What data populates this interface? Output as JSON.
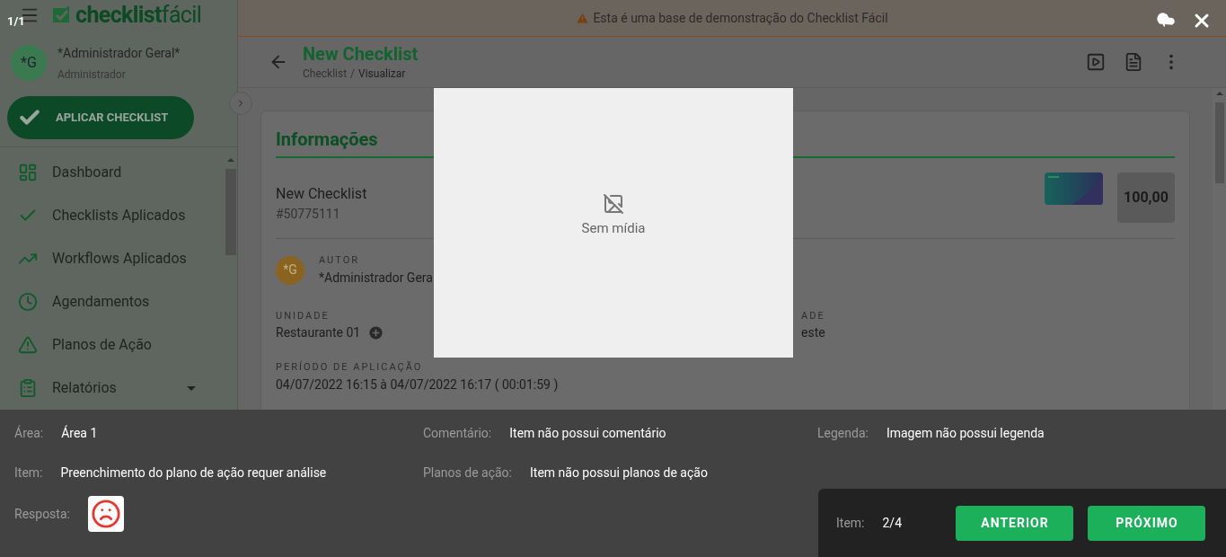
{
  "banner": "Esta é uma base de demonstração do Checklist Fácil",
  "sidebar": {
    "logo": {
      "bold": "checklist",
      "light": "fácil"
    },
    "user": {
      "initials": "*G",
      "name": "*Administrador Geral*",
      "role": "Administrador"
    },
    "action": "APLICAR CHECKLIST",
    "items": [
      {
        "label": "Dashboard",
        "expandable": false
      },
      {
        "label": "Checklists Aplicados",
        "expandable": false
      },
      {
        "label": "Workflows Aplicados",
        "expandable": false
      },
      {
        "label": "Agendamentos",
        "expandable": false
      },
      {
        "label": "Planos de Ação",
        "expandable": false
      },
      {
        "label": "Relatórios",
        "expandable": true
      }
    ]
  },
  "header": {
    "title": "New Checklist",
    "breadcrumb": [
      "Checklist",
      "Visualizar"
    ],
    "breadcrumb_separator": "/"
  },
  "info": {
    "heading": "Informações",
    "name": "New Checklist",
    "id": "#50775111",
    "score": "100,00",
    "author": {
      "initials": "*G",
      "label": "AUTOR",
      "name": "*Administrador Gera"
    },
    "unit": {
      "label": "UNIDADE",
      "value": "Restaurante 01"
    },
    "field_2": {
      "label": "ADE",
      "value": "este"
    },
    "period": {
      "label": "PERÍODO DE APLICAÇÃO",
      "value": "04/07/2022 16:15 à 04/07/2022 16:17 ( 00:01:59 )"
    }
  },
  "lightbox": {
    "counter": "1/1",
    "media": {
      "message": "Sem mídia"
    },
    "details": [
      {
        "label": "Área:",
        "value": "Área 1"
      },
      {
        "label": "Comentário:",
        "value": "Item não possui comentário"
      },
      {
        "label": "Legenda:",
        "value": "Imagem não possui legenda"
      },
      {
        "label": "Item:",
        "value": "Preenchimento do plano de ação requer análise"
      },
      {
        "label": "Planos de ação:",
        "value": "Item não possui planos de ação"
      }
    ],
    "answer": {
      "label": "Resposta:",
      "kind": "sad"
    },
    "pager": {
      "label": "Item:",
      "value": "2/4",
      "buttons": [
        "ANTERIOR",
        "PRÓXIMO"
      ]
    }
  }
}
